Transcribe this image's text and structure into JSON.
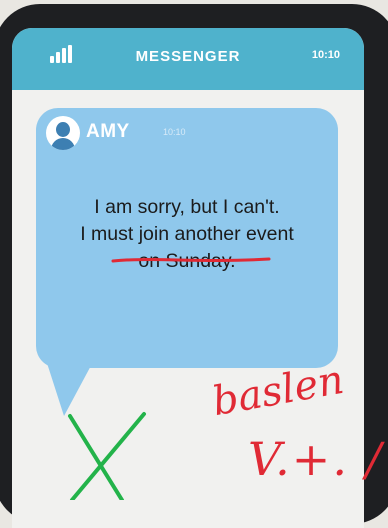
{
  "header": {
    "app_title": "MESSENGER",
    "clock": "10:10",
    "signal_icon": "signal-bars-icon"
  },
  "message": {
    "sender": "AMY",
    "time": "10:10",
    "line1": "I am sorry, but I can't.",
    "line2": "I must join another event",
    "line3": "on Sunday.",
    "avatar_icon": "user-avatar-icon"
  },
  "annotations": {
    "handwriting_top": "baslen",
    "handwriting_bottom": "V.+. /",
    "cross_mark": "green-x-mark",
    "colors": {
      "red_ink": "#e02a35",
      "green_ink": "#23b34a"
    }
  },
  "colors": {
    "header_bg": "#4fb2cc",
    "bubble_bg": "#8fc8ec",
    "phone_frame": "#1e1f22"
  }
}
